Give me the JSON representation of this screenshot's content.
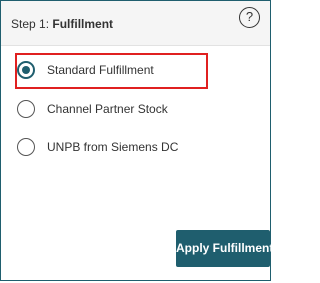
{
  "panel": {
    "step_label": "Step 1: ",
    "step_title": "Fulfillment",
    "help_icon": "question-circle-icon"
  },
  "options": [
    {
      "label": "Standard Fulfillment",
      "selected": true
    },
    {
      "label": "Channel Partner Stock",
      "selected": false
    },
    {
      "label": "UNPB from Siemens DC",
      "selected": false
    }
  ],
  "actions": {
    "apply_label": "Apply Fulfillment"
  },
  "colors": {
    "accent": "#1f5e6e",
    "highlight": "#e02020"
  }
}
